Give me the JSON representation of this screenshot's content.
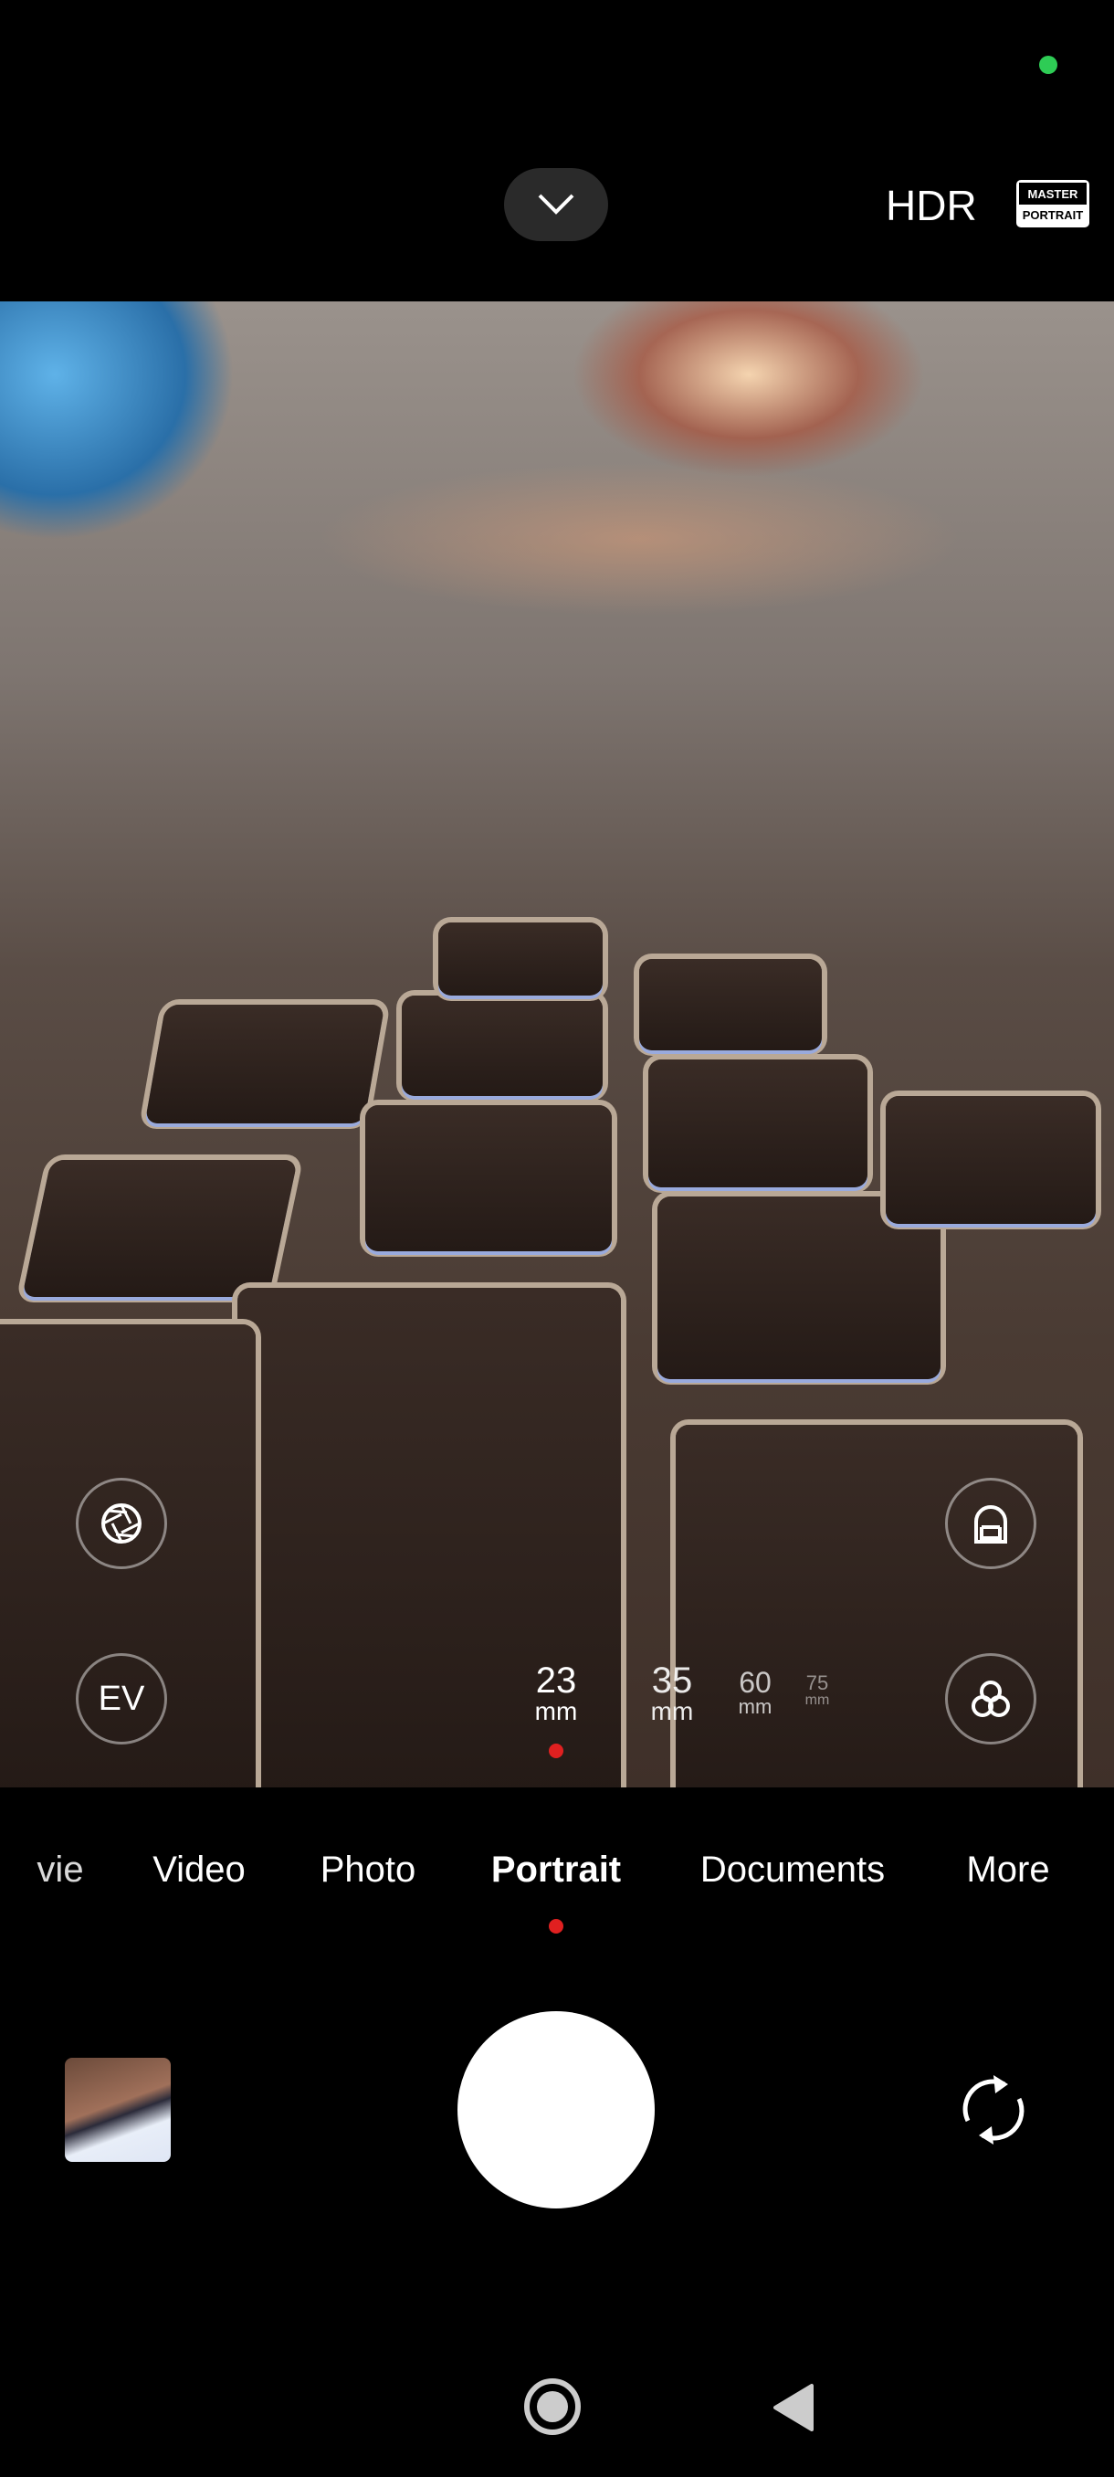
{
  "status": {
    "privacy_indicator_color": "#2ecc55"
  },
  "top_bar": {
    "collapse_icon": "chevron-down-icon",
    "hdr_label": "HDR",
    "master_badge": {
      "line1": "MASTER",
      "line2": "PORTRAIT"
    }
  },
  "viewfinder": {
    "left_controls": [
      {
        "icon": "aperture-icon"
      },
      {
        "label": "EV"
      }
    ],
    "right_controls": [
      {
        "icon": "portrait-lighting-icon"
      },
      {
        "icon": "filters-icon"
      }
    ],
    "focal_lengths": [
      {
        "value": "23",
        "unit": "mm",
        "selected": true
      },
      {
        "value": "35",
        "unit": "mm"
      },
      {
        "value": "60",
        "unit": "mm"
      },
      {
        "value": "75",
        "unit": "mm"
      }
    ],
    "accent_color": "#e02020"
  },
  "modes": {
    "items": [
      "vie",
      "Video",
      "Photo",
      "Portrait",
      "Documents",
      "More"
    ],
    "selected": "Portrait"
  },
  "bottom": {
    "gallery_thumbnail": "gallery-thumbnail",
    "shutter": "shutter-button",
    "flip_icon": "switch-camera-icon"
  },
  "nav": {
    "home": "home-icon",
    "back": "back-icon"
  }
}
